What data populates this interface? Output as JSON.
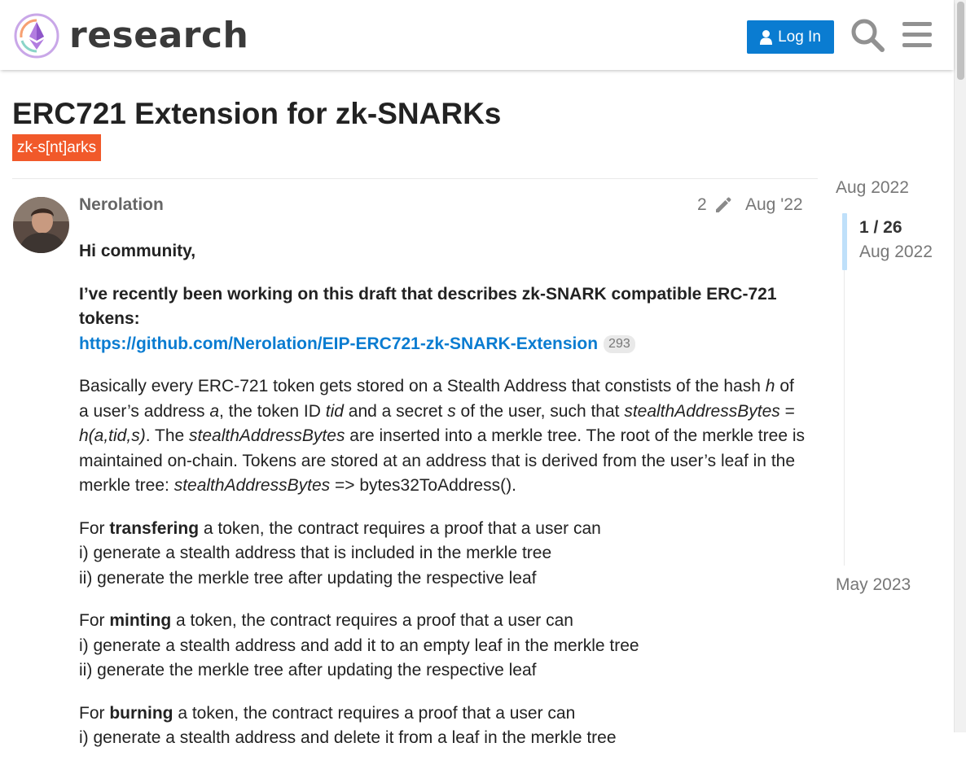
{
  "header": {
    "logo_text": "research",
    "login_label": "Log In",
    "icons": [
      "ethereum-logo-icon",
      "user-icon",
      "search-icon",
      "hamburger-menu-icon"
    ]
  },
  "topic": {
    "title": "ERC721 Extension for zk-SNARKs",
    "tag": "zk-s[nt]arks"
  },
  "post": {
    "username": "Nerolation",
    "edit_count": "2",
    "date": "Aug '22",
    "greeting": "Hi community,",
    "intro": "I’ve recently been working on this draft that describes zk-SNARK compatible ERC-721 tokens:",
    "link_text": "https://github.com/Nerolation/EIP-ERC721-zk-SNARK-Extension",
    "link_clicks": "293",
    "para1": {
      "t1": "Basically every ERC-721 token gets stored on a Stealth Address that constists of the hash ",
      "i1": "h",
      "t2": " of a user’s address ",
      "i2": "a",
      "t3": ", the token ID ",
      "i3": "tid",
      "t4": " and a secret ",
      "i4": "s",
      "t5": " of the user, such that ",
      "i5": "stealthAddressBytes",
      "t6": " = ",
      "i6": "h(a,tid,s)",
      "t7": ". The ",
      "i7": "stealthAddressBytes",
      "t8": " are inserted into a merkle tree. The root of the merkle tree is maintained on-chain. Tokens are stored at an address that is derived from the user’s leaf in the merkle tree: ",
      "i8": "stealthAddressBytes",
      "t9": " => bytes32ToAddress()."
    },
    "transfer": {
      "prefix": "For ",
      "bold": "transfering",
      "rest": " a token, the contract requires a proof that a user can",
      "line1": "i) generate a stealth address that is included in the merkle tree",
      "line2": "ii) generate the merkle tree after updating the respective leaf"
    },
    "mint": {
      "prefix": "For ",
      "bold": "minting",
      "rest": " a token, the contract requires a proof that a user can",
      "line1": "i) generate a stealth address and add it to an empty leaf in the merkle tree",
      "line2": "ii) generate the merkle tree after updating the respective leaf"
    },
    "burn": {
      "prefix": "For ",
      "bold": "burning",
      "rest": " a token, the contract requires a proof that a user can",
      "line1": "i) generate a stealth address and delete it from a leaf in the merkle tree"
    }
  },
  "timeline": {
    "start_date": "Aug 2022",
    "position": "1 / 26",
    "position_date": "Aug 2022",
    "end_date": "May 2023"
  },
  "colors": {
    "accent": "#0a7cd1",
    "tag": "#f1592a",
    "timeline_handle": "#bfe0fa"
  }
}
